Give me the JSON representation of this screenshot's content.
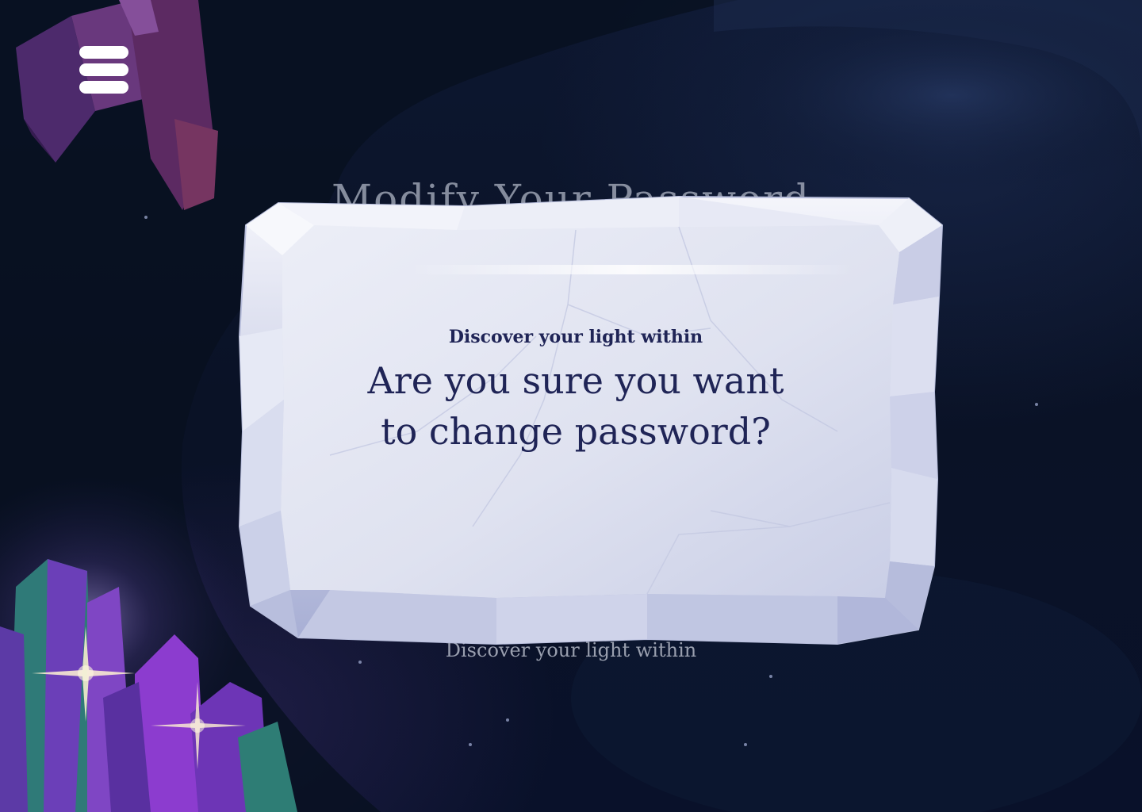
{
  "page": {
    "title": "Modify Your Password",
    "tagline": "Discover your light within"
  },
  "menu": {
    "icon": "hamburger-menu-icon"
  },
  "modal": {
    "kicker": "Discover your light within",
    "question_line1": "Are you sure you want",
    "question_line2": "to change password?"
  },
  "colors": {
    "background": "#0b1428",
    "modal_text": "#1f2456",
    "ice_light": "#e4e7f3",
    "ice_shadow": "#aab1d6",
    "crystal_purple": "#6a3fb0",
    "crystal_teal": "#2f8a86"
  }
}
